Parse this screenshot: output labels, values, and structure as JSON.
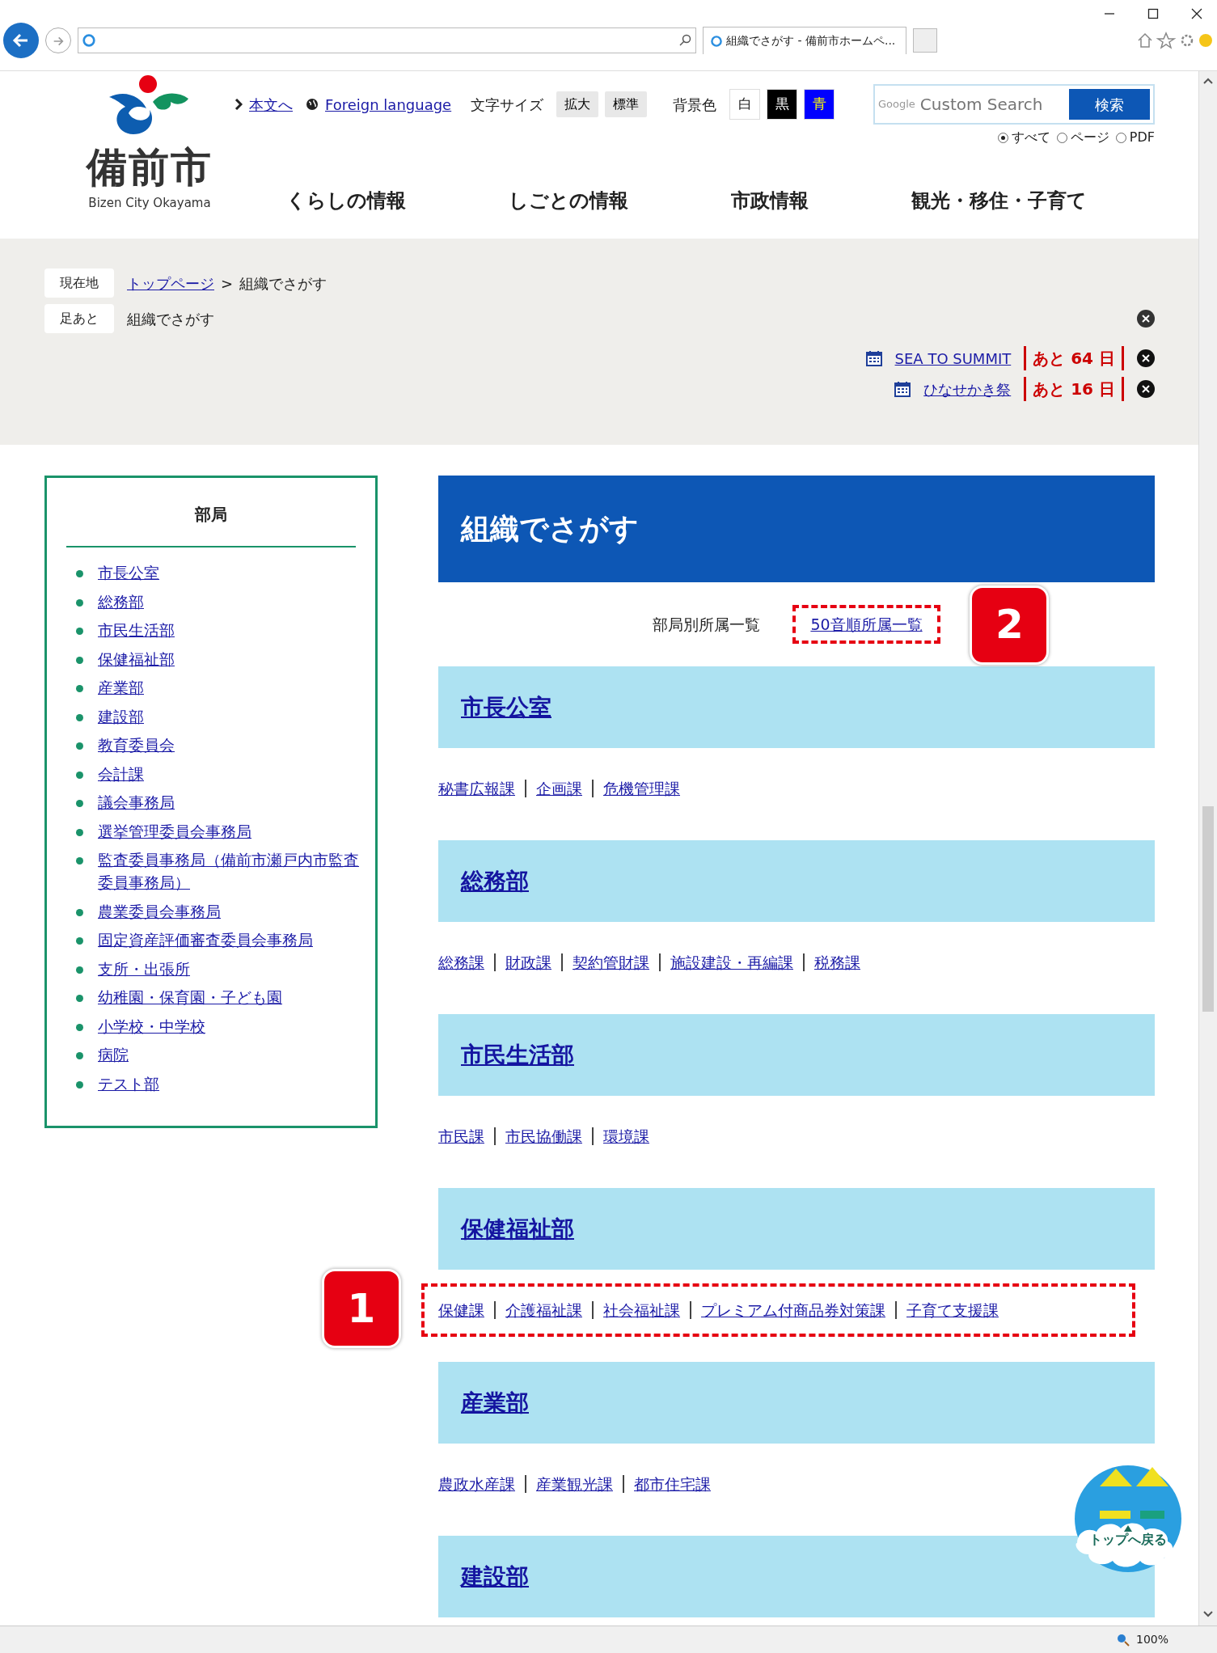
{
  "browser": {
    "tab_title": "組織でさがす - 備前市ホームペ...",
    "zoom": "100%"
  },
  "header": {
    "logo_text": "備前市",
    "logo_subtext": "Bizen City Okayama",
    "utility_links": [
      {
        "kind": "chevron",
        "text": "本文へ"
      },
      {
        "kind": "globe",
        "text": "Foreign language"
      }
    ],
    "text_size": {
      "label": "文字サイズ",
      "buttons": [
        "拡大",
        "標準"
      ]
    },
    "background": {
      "label": "背景色",
      "buttons": [
        {
          "label": "白",
          "color": "#ffffff"
        },
        {
          "label": "黒",
          "color": "#000000"
        },
        {
          "label": "青",
          "color": "#0000ff"
        }
      ]
    },
    "search": {
      "brand": "Google",
      "placeholder": "Custom Search",
      "button": "検索",
      "options": [
        {
          "label": "すべて",
          "selected": true
        },
        {
          "label": "ページ",
          "selected": false
        },
        {
          "label": "PDF",
          "selected": false
        }
      ]
    },
    "nav": [
      "くらしの情報",
      "しごとの情報",
      "市政情報",
      "観光・移住・子育て"
    ]
  },
  "breadcrumb": {
    "label": "現在地",
    "links": [
      "トップページ"
    ],
    "separator": ">",
    "current": "組織でさがす"
  },
  "footprints": {
    "label": "足あと",
    "items": [
      "組織でさがす"
    ]
  },
  "events": [
    {
      "title": "SEA TO SUMMIT",
      "countdown": "あと 64 日"
    },
    {
      "title": "ひなせかき祭",
      "countdown": "あと 16 日"
    }
  ],
  "sidebar": {
    "title": "部局",
    "items": [
      "市長公室",
      "総務部",
      "市民生活部",
      "保健福祉部",
      "産業部",
      "建設部",
      "教育委員会",
      "会計課",
      "議会事務局",
      "選挙管理委員会事務局",
      "監査委員事務局（備前市瀬戸内市監査委員事務局）",
      "農業委員会事務局",
      "固定資産評価審査委員会事務局",
      "支所・出張所",
      "幼稚園・保育園・子ども園",
      "小学校・中学校",
      "病院",
      "テスト部"
    ]
  },
  "page_title": "組織でさがす",
  "tabs": [
    {
      "label": "部局別所属一覧",
      "selected": true
    },
    {
      "label": "50音順所属一覧",
      "selected": false,
      "callout": "2"
    }
  ],
  "sections": [
    {
      "title": "市長公室",
      "links": [
        "秘書広報課",
        "企画課",
        "危機管理課"
      ]
    },
    {
      "title": "総務部",
      "links": [
        "総務課",
        "財政課",
        "契約管財課",
        "施設建設・再編課",
        "税務課"
      ]
    },
    {
      "title": "市民生活部",
      "links": [
        "市民課",
        "市民協働課",
        "環境課"
      ]
    },
    {
      "title": "保健福祉部",
      "links": [
        "保健課",
        "介護福祉課",
        "社会福祉課",
        "プレミアム付商品券対策課",
        "子育て支援課"
      ],
      "callout": "1"
    },
    {
      "title": "産業部",
      "links": [
        "農政水産課",
        "産業観光課",
        "都市住宅課"
      ]
    },
    {
      "title": "建設部"
    }
  ],
  "back_to_top": "トップへ戻る"
}
